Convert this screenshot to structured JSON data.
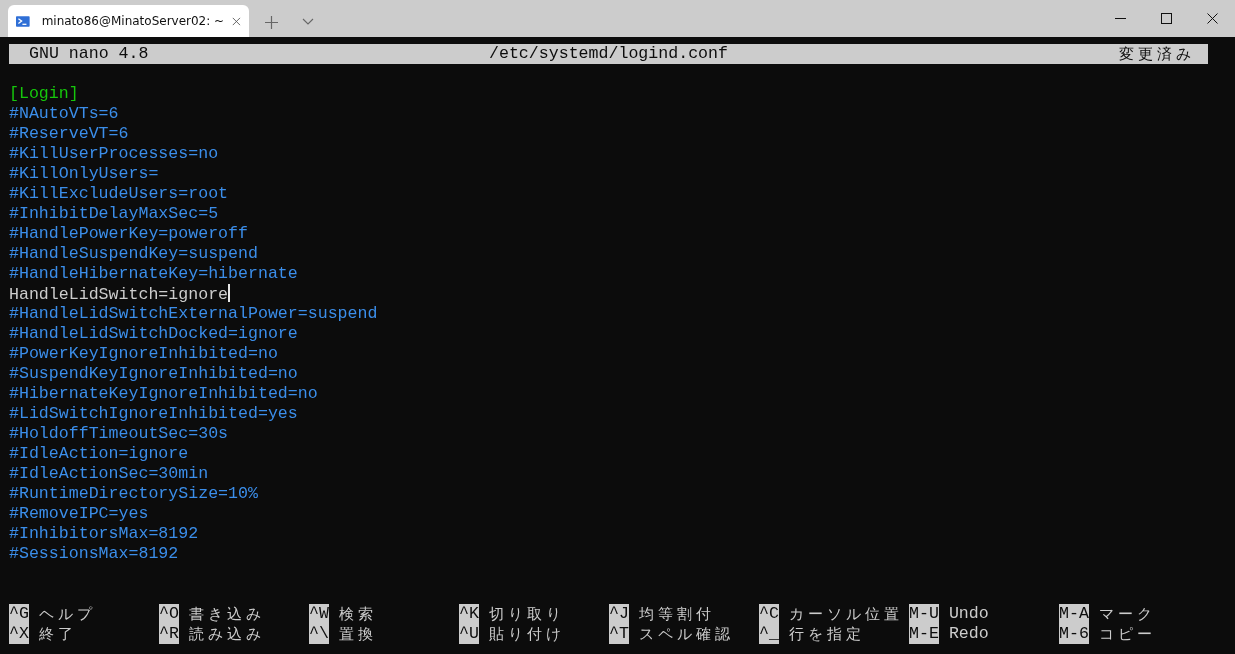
{
  "window": {
    "tab_title": "minato86@MinatoServer02: ~"
  },
  "editor": {
    "app": "GNU nano 4.8",
    "file": "/etc/systemd/logind.conf",
    "status": "変更済み"
  },
  "lines": [
    {
      "kind": "section",
      "text": "[Login]"
    },
    {
      "kind": "comment",
      "text": "#NAutoVTs=6"
    },
    {
      "kind": "comment",
      "text": "#ReserveVT=6"
    },
    {
      "kind": "comment",
      "text": "#KillUserProcesses=no"
    },
    {
      "kind": "comment",
      "text": "#KillOnlyUsers="
    },
    {
      "kind": "comment",
      "text": "#KillExcludeUsers=root"
    },
    {
      "kind": "comment",
      "text": "#InhibitDelayMaxSec=5"
    },
    {
      "kind": "comment",
      "text": "#HandlePowerKey=poweroff"
    },
    {
      "kind": "comment",
      "text": "#HandleSuspendKey=suspend"
    },
    {
      "kind": "comment",
      "text": "#HandleHibernateKey=hibernate"
    },
    {
      "kind": "setting",
      "text": "HandleLidSwitch=ignore",
      "cursor": true
    },
    {
      "kind": "comment",
      "text": "#HandleLidSwitchExternalPower=suspend"
    },
    {
      "kind": "comment",
      "text": "#HandleLidSwitchDocked=ignore"
    },
    {
      "kind": "comment",
      "text": "#PowerKeyIgnoreInhibited=no"
    },
    {
      "kind": "comment",
      "text": "#SuspendKeyIgnoreInhibited=no"
    },
    {
      "kind": "comment",
      "text": "#HibernateKeyIgnoreInhibited=no"
    },
    {
      "kind": "comment",
      "text": "#LidSwitchIgnoreInhibited=yes"
    },
    {
      "kind": "comment",
      "text": "#HoldoffTimeoutSec=30s"
    },
    {
      "kind": "comment",
      "text": "#IdleAction=ignore"
    },
    {
      "kind": "comment",
      "text": "#IdleActionSec=30min"
    },
    {
      "kind": "comment",
      "text": "#RuntimeDirectorySize=10%"
    },
    {
      "kind": "comment",
      "text": "#RemoveIPC=yes"
    },
    {
      "kind": "comment",
      "text": "#InhibitorsMax=8192"
    },
    {
      "kind": "comment",
      "text": "#SessionsMax=8192"
    }
  ],
  "shortcuts": [
    [
      {
        "key": "^G",
        "label": "ヘルプ"
      },
      {
        "key": "^O",
        "label": "書き込み"
      },
      {
        "key": "^W",
        "label": "検索"
      },
      {
        "key": "^K",
        "label": "切り取り"
      },
      {
        "key": "^J",
        "label": "均等割付"
      },
      {
        "key": "^C",
        "label": "カーソル位置"
      },
      {
        "key": "M-U",
        "label": "Undo"
      },
      {
        "key": "M-A",
        "label": "マーク"
      }
    ],
    [
      {
        "key": "^X",
        "label": "終了"
      },
      {
        "key": "^R",
        "label": "読み込み"
      },
      {
        "key": "^\\",
        "label": "置換"
      },
      {
        "key": "^U",
        "label": "貼り付け"
      },
      {
        "key": "^T",
        "label": "スペル確認"
      },
      {
        "key": "^_",
        "label": "行を指定"
      },
      {
        "key": "M-E",
        "label": "Redo"
      },
      {
        "key": "M-6",
        "label": "コピー"
      }
    ]
  ]
}
